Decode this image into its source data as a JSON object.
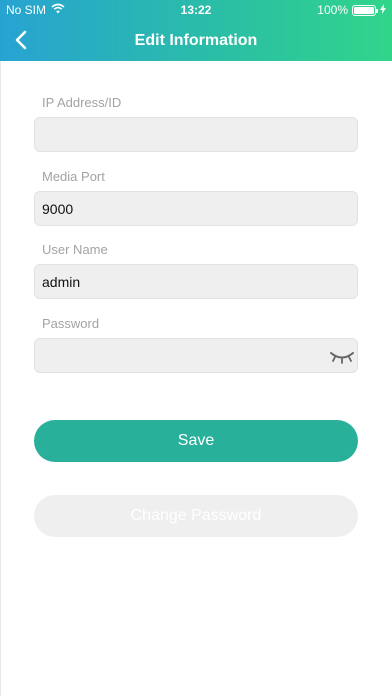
{
  "status_bar": {
    "carrier": "No SIM",
    "time": "13:22",
    "battery": "100%",
    "battery_level": 1.0
  },
  "nav": {
    "title": "Edit Information",
    "back_icon": "chevron-left-icon"
  },
  "form": {
    "ip": {
      "label": "IP Address/ID",
      "value": ""
    },
    "port": {
      "label": "Media Port",
      "value": "9000"
    },
    "username": {
      "label": "User Name",
      "value": "admin"
    },
    "password": {
      "label": "Password",
      "value": "",
      "toggle_icon": "eye-closed-icon"
    }
  },
  "buttons": {
    "save": "Save",
    "change_password": "Change Password"
  },
  "colors": {
    "header_gradient": [
      "#27a3d2",
      "#30d58a"
    ],
    "save_button": "#28b09a",
    "field_background": "#efefef"
  }
}
